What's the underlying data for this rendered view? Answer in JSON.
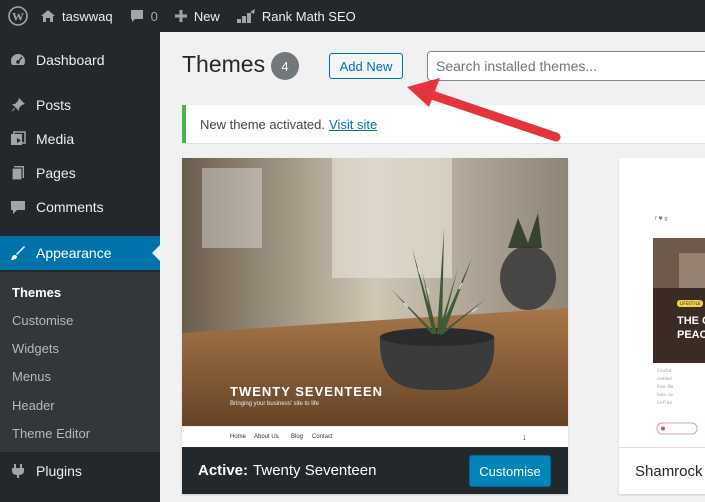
{
  "adminbar": {
    "site_name": "taswwaq",
    "comments_count": "0",
    "new_label": "New",
    "rank_math_label": "Rank Math SEO"
  },
  "sidebar": {
    "items": [
      {
        "label": "Dashboard",
        "icon": "dashboard-icon"
      },
      {
        "label": "Posts",
        "icon": "pin-icon"
      },
      {
        "label": "Media",
        "icon": "media-icon"
      },
      {
        "label": "Pages",
        "icon": "pages-icon"
      },
      {
        "label": "Comments",
        "icon": "comment-icon"
      },
      {
        "label": "Appearance",
        "icon": "brush-icon",
        "active": true
      },
      {
        "label": "Plugins",
        "icon": "plugin-icon"
      }
    ],
    "submenu": [
      {
        "label": "Themes",
        "current": true
      },
      {
        "label": "Customise"
      },
      {
        "label": "Widgets"
      },
      {
        "label": "Menus"
      },
      {
        "label": "Header"
      },
      {
        "label": "Theme Editor"
      }
    ]
  },
  "main": {
    "title": "Themes",
    "count": "4",
    "add_new_label": "Add New",
    "search_placeholder": "Search installed themes...",
    "notice": {
      "text": "New theme activated.",
      "link": "Visit site"
    }
  },
  "themes": [
    {
      "screenshot_title": "TWENTY SEVENTEEN",
      "screenshot_subtitle": "Bringing your business' site to life",
      "screenshot_nav": [
        "Home",
        "About Us",
        "Blog",
        "Contact"
      ],
      "active_prefix": "Active:",
      "name": "Twenty Seventeen",
      "customise_label": "Customise"
    },
    {
      "name": "Shamrock",
      "screenshot_badge": "LIFESTYLE",
      "screenshot_heading": [
        "THE C",
        "PEAC"
      ]
    }
  ],
  "colors": {
    "admin_dark": "#23282d",
    "accent_blue": "#0073aa",
    "notice_green": "#46b450",
    "arrow_red": "#e4353c"
  }
}
